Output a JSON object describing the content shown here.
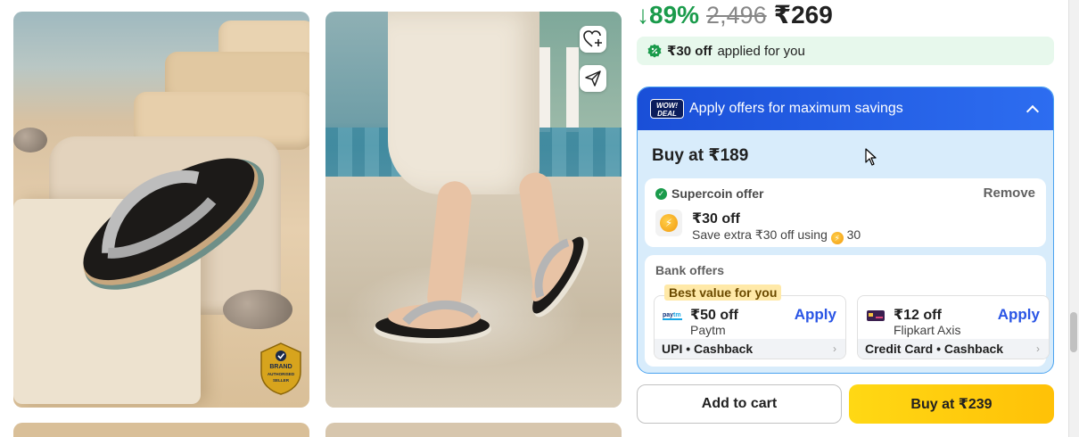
{
  "pricing": {
    "discount": "↓89%",
    "mrp": "2,496",
    "price": "₹269"
  },
  "applied_strip": {
    "amount": "₹30 off",
    "text": "applied for you"
  },
  "offers_card": {
    "badge": "WOW! DEAL",
    "header": "Apply offers for maximum savings",
    "buy_at": "Buy at ₹189",
    "supercoin": {
      "title": "Supercoin offer",
      "remove_label": "Remove",
      "amount": "₹30 off",
      "description": "Save extra ₹30 off using",
      "coins": "30"
    },
    "bank": {
      "title": "Bank offers",
      "best_value_label": "Best value for you",
      "offers": [
        {
          "amount": "₹50 off",
          "bank": "Paytm",
          "apply_label": "Apply",
          "footer": "UPI • Cashback",
          "logo": "paytm-logo"
        },
        {
          "amount": "₹12 off",
          "bank": "Flipkart Axis",
          "apply_label": "Apply",
          "footer": "Credit Card • Cashback",
          "logo": "card-logo"
        }
      ]
    }
  },
  "brand_badge": {
    "line1": "BRAND",
    "line2": "AUTHORISED",
    "line3": "SELLER"
  },
  "actions": {
    "add_to_cart": "Add to cart",
    "buy_now": "Buy at ₹239"
  },
  "colors": {
    "discount_green": "#1a9b4b",
    "offer_header_blue": "#1a4fd8",
    "apply_blue": "#2a55e5",
    "buy_yellow": "#ffd814"
  }
}
